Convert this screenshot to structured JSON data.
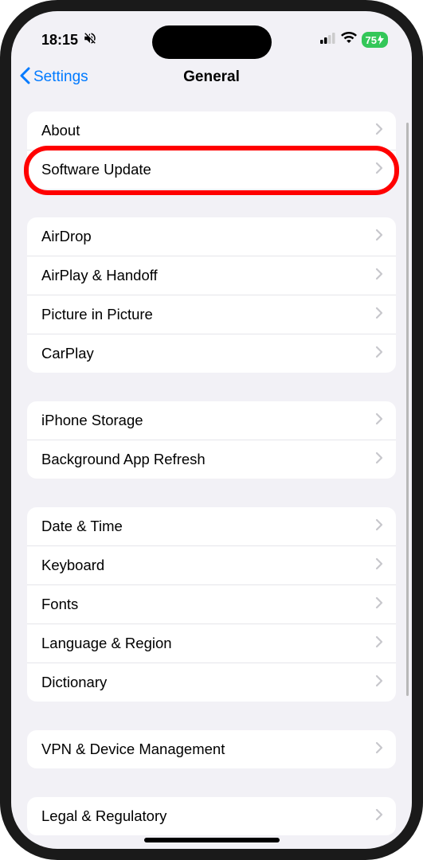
{
  "status": {
    "time": "18:15",
    "silent_icon": "🔕",
    "battery_text": "75"
  },
  "nav": {
    "back_label": "Settings",
    "title": "General"
  },
  "sections": [
    {
      "items": [
        {
          "label": "About",
          "highlighted": false
        },
        {
          "label": "Software Update",
          "highlighted": true
        }
      ]
    },
    {
      "items": [
        {
          "label": "AirDrop",
          "highlighted": false
        },
        {
          "label": "AirPlay & Handoff",
          "highlighted": false
        },
        {
          "label": "Picture in Picture",
          "highlighted": false
        },
        {
          "label": "CarPlay",
          "highlighted": false
        }
      ]
    },
    {
      "items": [
        {
          "label": "iPhone Storage",
          "highlighted": false
        },
        {
          "label": "Background App Refresh",
          "highlighted": false
        }
      ]
    },
    {
      "items": [
        {
          "label": "Date & Time",
          "highlighted": false
        },
        {
          "label": "Keyboard",
          "highlighted": false
        },
        {
          "label": "Fonts",
          "highlighted": false
        },
        {
          "label": "Language & Region",
          "highlighted": false
        },
        {
          "label": "Dictionary",
          "highlighted": false
        }
      ]
    },
    {
      "items": [
        {
          "label": "VPN & Device Management",
          "highlighted": false
        }
      ]
    },
    {
      "items": [
        {
          "label": "Legal & Regulatory",
          "highlighted": false
        }
      ]
    }
  ]
}
